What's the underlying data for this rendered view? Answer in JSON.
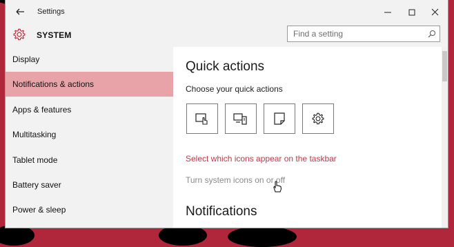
{
  "window": {
    "title": "Settings"
  },
  "header": {
    "title": "SYSTEM",
    "search_placeholder": "Find a setting"
  },
  "sidebar": {
    "items": [
      {
        "label": "Display"
      },
      {
        "label": "Notifications & actions",
        "active": true
      },
      {
        "label": "Apps & features"
      },
      {
        "label": "Multitasking"
      },
      {
        "label": "Tablet mode"
      },
      {
        "label": "Battery saver"
      },
      {
        "label": "Power & sleep"
      }
    ]
  },
  "main": {
    "quick_actions_title": "Quick actions",
    "quick_actions_subtitle": "Choose your quick actions",
    "tiles": [
      {
        "icon": "tablet-mode-icon"
      },
      {
        "icon": "connect-icon"
      },
      {
        "icon": "note-icon"
      },
      {
        "icon": "settings-gear-icon"
      }
    ],
    "taskbar_link": "Select which icons appear on the taskbar",
    "system_icons_link": "Turn system icons on or off",
    "notifications_title": "Notifications"
  },
  "colors": {
    "accent": "#c43746",
    "selected_bg": "#e8a3a9",
    "desktop_bg": "#b0263a"
  }
}
